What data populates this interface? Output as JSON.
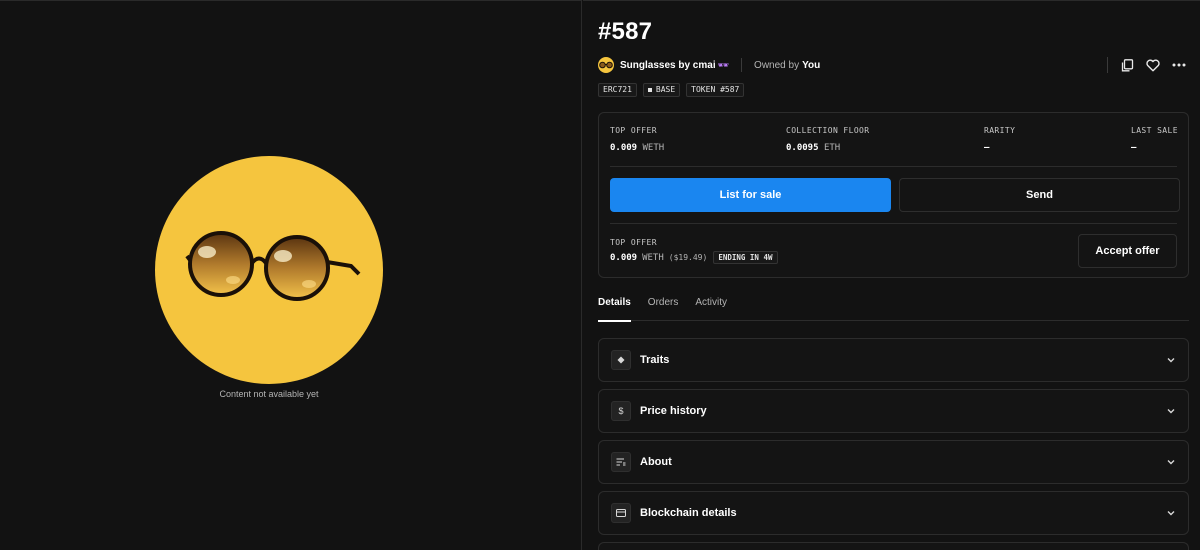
{
  "media": {
    "caption": "Content not available yet",
    "background_color": "#f5c53e"
  },
  "token": {
    "title": "#587",
    "collection_name": "Sunglasses by cmai",
    "collection_emoji": "🕶",
    "owned_by_label": "Owned by",
    "owner": "You"
  },
  "actions": {
    "copy_icon": "copy-icon",
    "favorite_icon": "heart-icon",
    "more_icon": "more-icon"
  },
  "chips": {
    "standard": "ERC721",
    "chain": "BASE",
    "token_id": "TOKEN #587"
  },
  "stats": {
    "top_offer_label": "TOP OFFER",
    "top_offer_value": "0.009",
    "top_offer_unit": "WETH",
    "floor_label": "COLLECTION FLOOR",
    "floor_value": "0.0095",
    "floor_unit": "ETH",
    "rarity_label": "RARITY",
    "rarity_value": "–",
    "last_sale_label": "LAST SALE",
    "last_sale_value": "–"
  },
  "buttons": {
    "list_for_sale": "List for sale",
    "send": "Send",
    "accept_offer": "Accept offer"
  },
  "offer": {
    "label": "TOP OFFER",
    "amount": "0.009",
    "unit": "WETH",
    "usd": "($19.49)",
    "ending": "ENDING IN 4W"
  },
  "tabs": [
    {
      "label": "Details",
      "active": true
    },
    {
      "label": "Orders",
      "active": false
    },
    {
      "label": "Activity",
      "active": false
    }
  ],
  "sections": [
    {
      "label": "Traits",
      "icon": "diamond-icon"
    },
    {
      "label": "Price history",
      "icon": "dollar-icon"
    },
    {
      "label": "About",
      "icon": "text-icon"
    },
    {
      "label": "Blockchain details",
      "icon": "database-icon"
    }
  ],
  "colors": {
    "accent": "#1a86f0",
    "background": "#121212"
  }
}
